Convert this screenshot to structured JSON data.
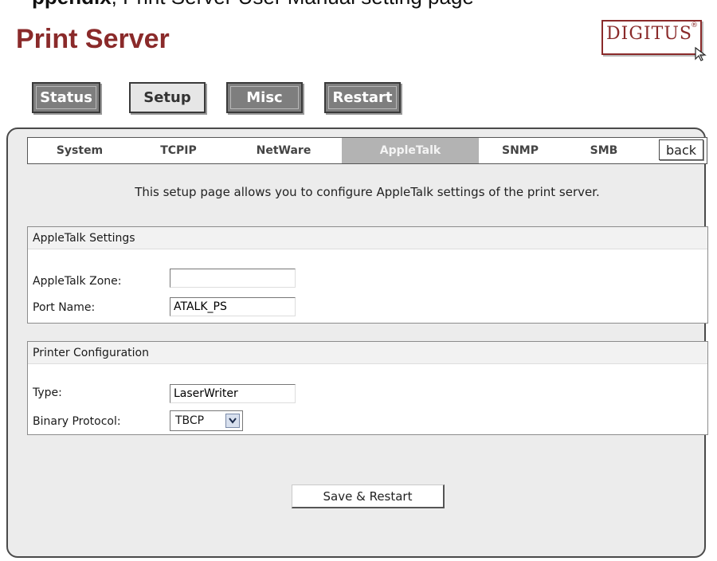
{
  "header": {
    "crop_text_bold": "ppendix",
    "crop_text_rest": ", Print Server User Manual setting page",
    "app_title": "Print Server",
    "logo_text": "DIGITUS",
    "logo_reg": "®"
  },
  "topnav": [
    {
      "label": "Status",
      "style": "dark"
    },
    {
      "label": "Setup",
      "style": "light"
    },
    {
      "label": "Misc",
      "style": "dark"
    },
    {
      "label": "Restart",
      "style": "dark"
    }
  ],
  "subnav": {
    "tabs": [
      {
        "label": "System",
        "active": false
      },
      {
        "label": "TCPIP",
        "active": false
      },
      {
        "label": "NetWare",
        "active": false
      },
      {
        "label": "AppleTalk",
        "active": true
      },
      {
        "label": "SNMP",
        "active": false
      },
      {
        "label": "SMB",
        "active": false
      }
    ],
    "back_label": "back"
  },
  "intro": "This setup page allows you to configure AppleTalk settings of the print server.",
  "appletalk_settings": {
    "title": "AppleTalk Settings",
    "zone_label": "AppleTalk Zone:",
    "zone_value": "",
    "port_label": "Port Name:",
    "port_value": "ATALK_PS"
  },
  "printer_config": {
    "title": "Printer Configuration",
    "type_label": "Type:",
    "type_value": "LaserWriter",
    "protocol_label": "Binary Protocol:",
    "protocol_value": "TBCP"
  },
  "save_label": "Save & Restart",
  "colors": {
    "brand": "#8a2a2a",
    "active_tab": "#b3b3b3",
    "panel_bg": "#ececec",
    "dark_button": "#7e7e7e"
  }
}
